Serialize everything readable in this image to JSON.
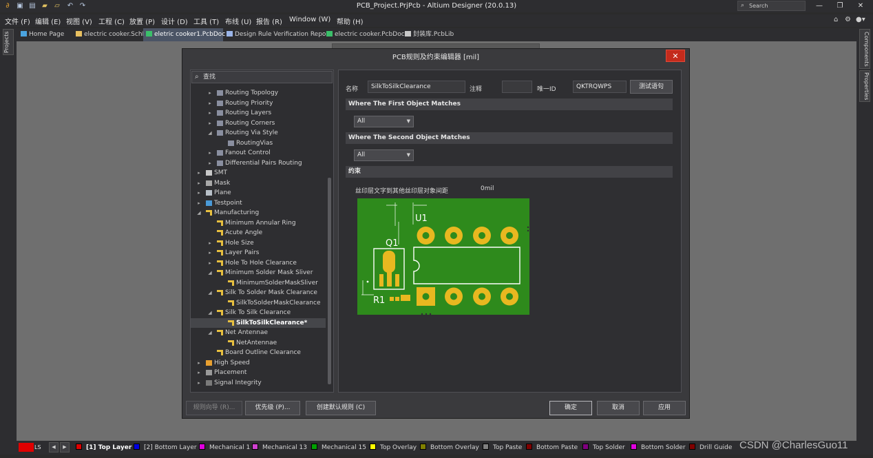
{
  "window": {
    "title": "PCB_Project.PrjPcb - Altium Designer (20.0.13)",
    "search_placeholder": "Search"
  },
  "menu": [
    "文件 (F)",
    "编辑 (E)",
    "视图 (V)",
    "工程 (C)",
    "放置 (P)",
    "设计 (D)",
    "工具 (T)",
    "布线 (U)",
    "报告 (R)",
    "Window (W)",
    "帮助 (H)"
  ],
  "side_panels": {
    "left": "Projects",
    "right": [
      "Components",
      "Properties"
    ]
  },
  "doc_tabs": [
    {
      "label": "Home Page",
      "icon": "home-icon",
      "color": "#4aa3df"
    },
    {
      "label": "electric cooker.SchDoc *",
      "icon": "schematic-icon",
      "color": "#e8c060"
    },
    {
      "label": "eletric cooker1.PcbDoc *",
      "icon": "pcb-icon",
      "color": "#3bbf6a"
    },
    {
      "label": "Design Rule Verification Report",
      "icon": "report-icon",
      "color": "#9ab4e8"
    },
    {
      "label": "electric cooker.PcbDoc *",
      "icon": "pcb-icon",
      "color": "#3bbf6a"
    },
    {
      "label": "封装库.PcbLib",
      "icon": "library-icon",
      "color": "#c8c8c8"
    }
  ],
  "dialog": {
    "title": "PCB规则及约束编辑器 [mil]",
    "tree_search": "查找",
    "tree": [
      {
        "label": "Routing Topology",
        "level": 2,
        "arrow": "right",
        "icon": "routing"
      },
      {
        "label": "Routing Priority",
        "level": 2,
        "arrow": "right",
        "icon": "routing"
      },
      {
        "label": "Routing Layers",
        "level": 2,
        "arrow": "right",
        "icon": "routing"
      },
      {
        "label": "Routing Corners",
        "level": 2,
        "arrow": "right",
        "icon": "routing"
      },
      {
        "label": "Routing Via Style",
        "level": 2,
        "arrow": "down",
        "icon": "routing"
      },
      {
        "label": "RoutingVias",
        "level": 3,
        "arrow": "",
        "icon": "routing"
      },
      {
        "label": "Fanout Control",
        "level": 2,
        "arrow": "right",
        "icon": "routing"
      },
      {
        "label": "Differential Pairs Routing",
        "level": 2,
        "arrow": "right",
        "icon": "routing"
      },
      {
        "label": "SMT",
        "level": 1,
        "arrow": "right",
        "icon": "smt"
      },
      {
        "label": "Mask",
        "level": 1,
        "arrow": "right",
        "icon": "mask"
      },
      {
        "label": "Plane",
        "level": 1,
        "arrow": "right",
        "icon": "plane"
      },
      {
        "label": "Testpoint",
        "level": 1,
        "arrow": "right",
        "icon": "testpoint"
      },
      {
        "label": "Manufacturing",
        "level": 1,
        "arrow": "down",
        "icon": "rule"
      },
      {
        "label": "Minimum Annular Ring",
        "level": 2,
        "arrow": "",
        "icon": "rule"
      },
      {
        "label": "Acute Angle",
        "level": 2,
        "arrow": "",
        "icon": "rule"
      },
      {
        "label": "Hole Size",
        "level": 2,
        "arrow": "right",
        "icon": "rule"
      },
      {
        "label": "Layer Pairs",
        "level": 2,
        "arrow": "right",
        "icon": "rule"
      },
      {
        "label": "Hole To Hole Clearance",
        "level": 2,
        "arrow": "right",
        "icon": "rule"
      },
      {
        "label": "Minimum Solder Mask Sliver",
        "level": 2,
        "arrow": "down",
        "icon": "rule"
      },
      {
        "label": "MinimumSolderMaskSliver",
        "level": 3,
        "arrow": "",
        "icon": "rule"
      },
      {
        "label": "Silk To Solder Mask Clearance",
        "level": 2,
        "arrow": "down",
        "icon": "rule"
      },
      {
        "label": "SilkToSolderMaskClearance",
        "level": 3,
        "arrow": "",
        "icon": "rule"
      },
      {
        "label": "Silk To Silk Clearance",
        "level": 2,
        "arrow": "down",
        "icon": "rule"
      },
      {
        "label": "SilkToSilkClearance*",
        "level": 3,
        "arrow": "",
        "icon": "rule",
        "selected": true
      },
      {
        "label": "Net Antennae",
        "level": 2,
        "arrow": "down",
        "icon": "rule"
      },
      {
        "label": "NetAntennae",
        "level": 3,
        "arrow": "",
        "icon": "rule"
      },
      {
        "label": "Board Outline Clearance",
        "level": 2,
        "arrow": "",
        "icon": "rule"
      },
      {
        "label": "High Speed",
        "level": 1,
        "arrow": "right",
        "icon": "highspeed"
      },
      {
        "label": "Placement",
        "level": 1,
        "arrow": "right",
        "icon": "placement"
      },
      {
        "label": "Signal Integrity",
        "level": 1,
        "arrow": "right",
        "icon": "signal"
      }
    ],
    "rule": {
      "name_label": "名称",
      "name_value": "SilkToSilkClearance",
      "comment_label": "注释",
      "comment_value": "",
      "id_label": "唯一ID",
      "id_value": "QKTRQWPS",
      "test_button": "测试语句",
      "first_match_header": "Where The First Object Matches",
      "first_match_value": "All",
      "second_match_header": "Where The Second Object Matches",
      "second_match_value": "All",
      "constraints_header": "约束",
      "constraint_label": "丝印层文字到其他丝印层对象间距",
      "constraint_value": "0mil",
      "pcb_labels": {
        "u1": "U1",
        "q1": "Q1",
        "r1": "R1"
      }
    },
    "buttons": {
      "wizard": "规则向导 (R)...",
      "priority": "优先级 (P)...",
      "create_default": "创建默认规则 (C)",
      "ok": "确定",
      "cancel": "取消",
      "apply": "应用"
    }
  },
  "layers": {
    "ls": "LS",
    "items": [
      {
        "label": "[1] Top Layer",
        "color": "#e00000",
        "active": true
      },
      {
        "label": "[2] Bottom Layer",
        "color": "#0000e0"
      },
      {
        "label": "Mechanical 1",
        "color": "#e000e0"
      },
      {
        "label": "Mechanical 13",
        "color": "#d040d0"
      },
      {
        "label": "Mechanical 15",
        "color": "#00a000"
      },
      {
        "label": "Top Overlay",
        "color": "#ffff00"
      },
      {
        "label": "Bottom Overlay",
        "color": "#808000"
      },
      {
        "label": "Top Paste",
        "color": "#808080"
      },
      {
        "label": "Bottom Paste",
        "color": "#800000"
      },
      {
        "label": "Top Solder",
        "color": "#800080"
      },
      {
        "label": "Bottom Solder",
        "color": "#e000e0"
      },
      {
        "label": "Drill Guide",
        "color": "#800000"
      }
    ]
  },
  "watermark": "CSDN @CharlesGuo11"
}
